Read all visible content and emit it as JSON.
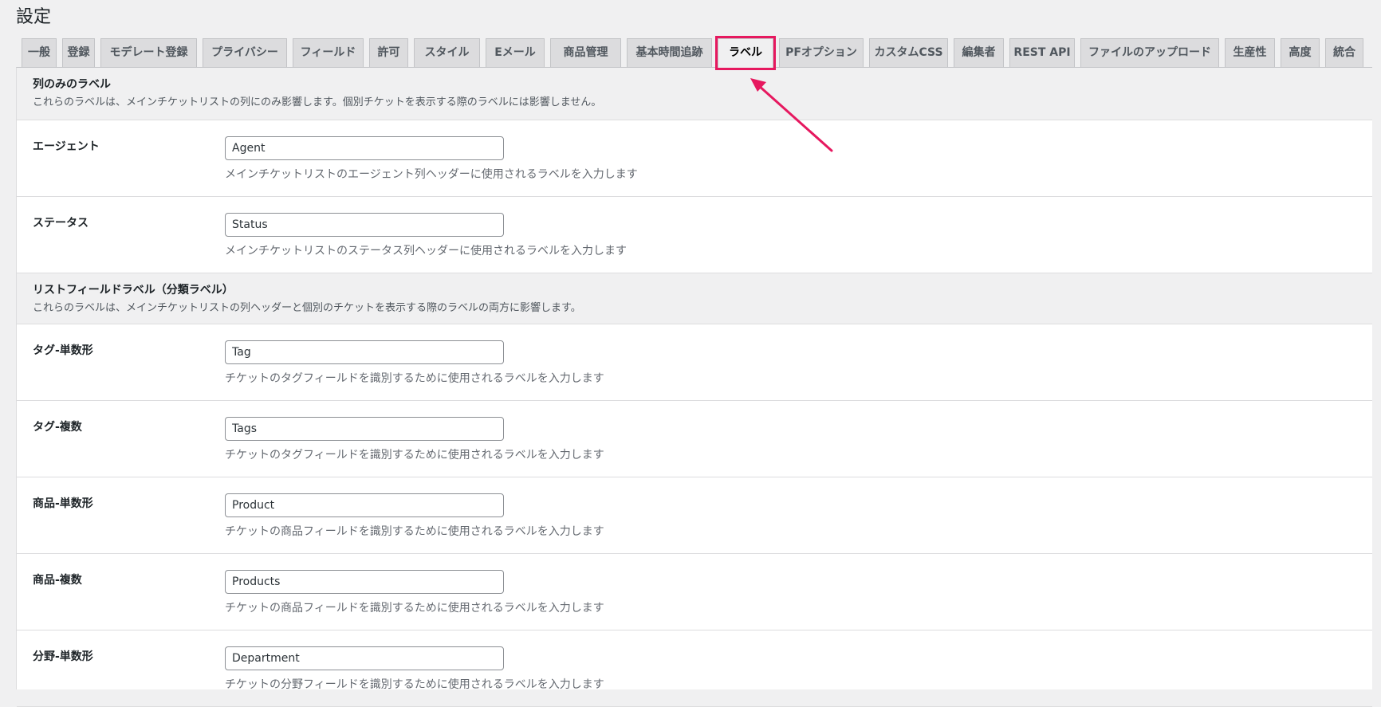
{
  "page": {
    "title": "設定"
  },
  "tabs": [
    {
      "label": "一般",
      "active": false
    },
    {
      "label": "登録",
      "active": false
    },
    {
      "label": "モデレート登録",
      "active": false
    },
    {
      "label": "プライバシー",
      "active": false
    },
    {
      "label": "フィールド",
      "active": false
    },
    {
      "label": "許可",
      "active": false
    },
    {
      "label": "スタイル",
      "active": false
    },
    {
      "label": "Eメール",
      "active": false
    },
    {
      "label": "商品管理",
      "active": false
    },
    {
      "label": "基本時間追跡",
      "active": false
    },
    {
      "label": "ラベル",
      "active": true
    },
    {
      "label": "PFオプション",
      "active": false
    },
    {
      "label": "カスタムCSS",
      "active": false
    },
    {
      "label": "編集者",
      "active": false
    },
    {
      "label": "REST API",
      "active": false
    },
    {
      "label": "ファイルのアップロード",
      "active": false
    },
    {
      "label": "生産性",
      "active": false
    },
    {
      "label": "高度",
      "active": false
    },
    {
      "label": "統合",
      "active": false
    }
  ],
  "sections": [
    {
      "title": "列のみのラベル",
      "description": "これらのラベルは、メインチケットリストの列にのみ影響します。個別チケットを表示する際のラベルには影響しません。",
      "fields": [
        {
          "label": "エージェント",
          "value": "Agent",
          "help": "メインチケットリストのエージェント列ヘッダーに使用されるラベルを入力します"
        },
        {
          "label": "ステータス",
          "value": "Status",
          "help": "メインチケットリストのステータス列ヘッダーに使用されるラベルを入力します"
        }
      ]
    },
    {
      "title": "リストフィールドラベル（分類ラベル）",
      "description": "これらのラベルは、メインチケットリストの列ヘッダーと個別のチケットを表示する際のラベルの両方に影響します。",
      "fields": [
        {
          "label": "タグ-単数形",
          "value": "Tag",
          "help": "チケットのタグフィールドを識別するために使用されるラベルを入力します"
        },
        {
          "label": "タグ-複数",
          "value": "Tags",
          "help": "チケットのタグフィールドを識別するために使用されるラベルを入力します"
        },
        {
          "label": "商品-単数形",
          "value": "Product",
          "help": "チケットの商品フィールドを識別するために使用されるラベルを入力します"
        },
        {
          "label": "商品-複数",
          "value": "Products",
          "help": "チケットの商品フィールドを識別するために使用されるラベルを入力します"
        },
        {
          "label": "分野-単数形",
          "value": "Department",
          "help": "チケットの分野フィールドを識別するために使用されるラベルを入力します"
        }
      ]
    }
  ],
  "colors": {
    "highlight": "#e6185f"
  }
}
